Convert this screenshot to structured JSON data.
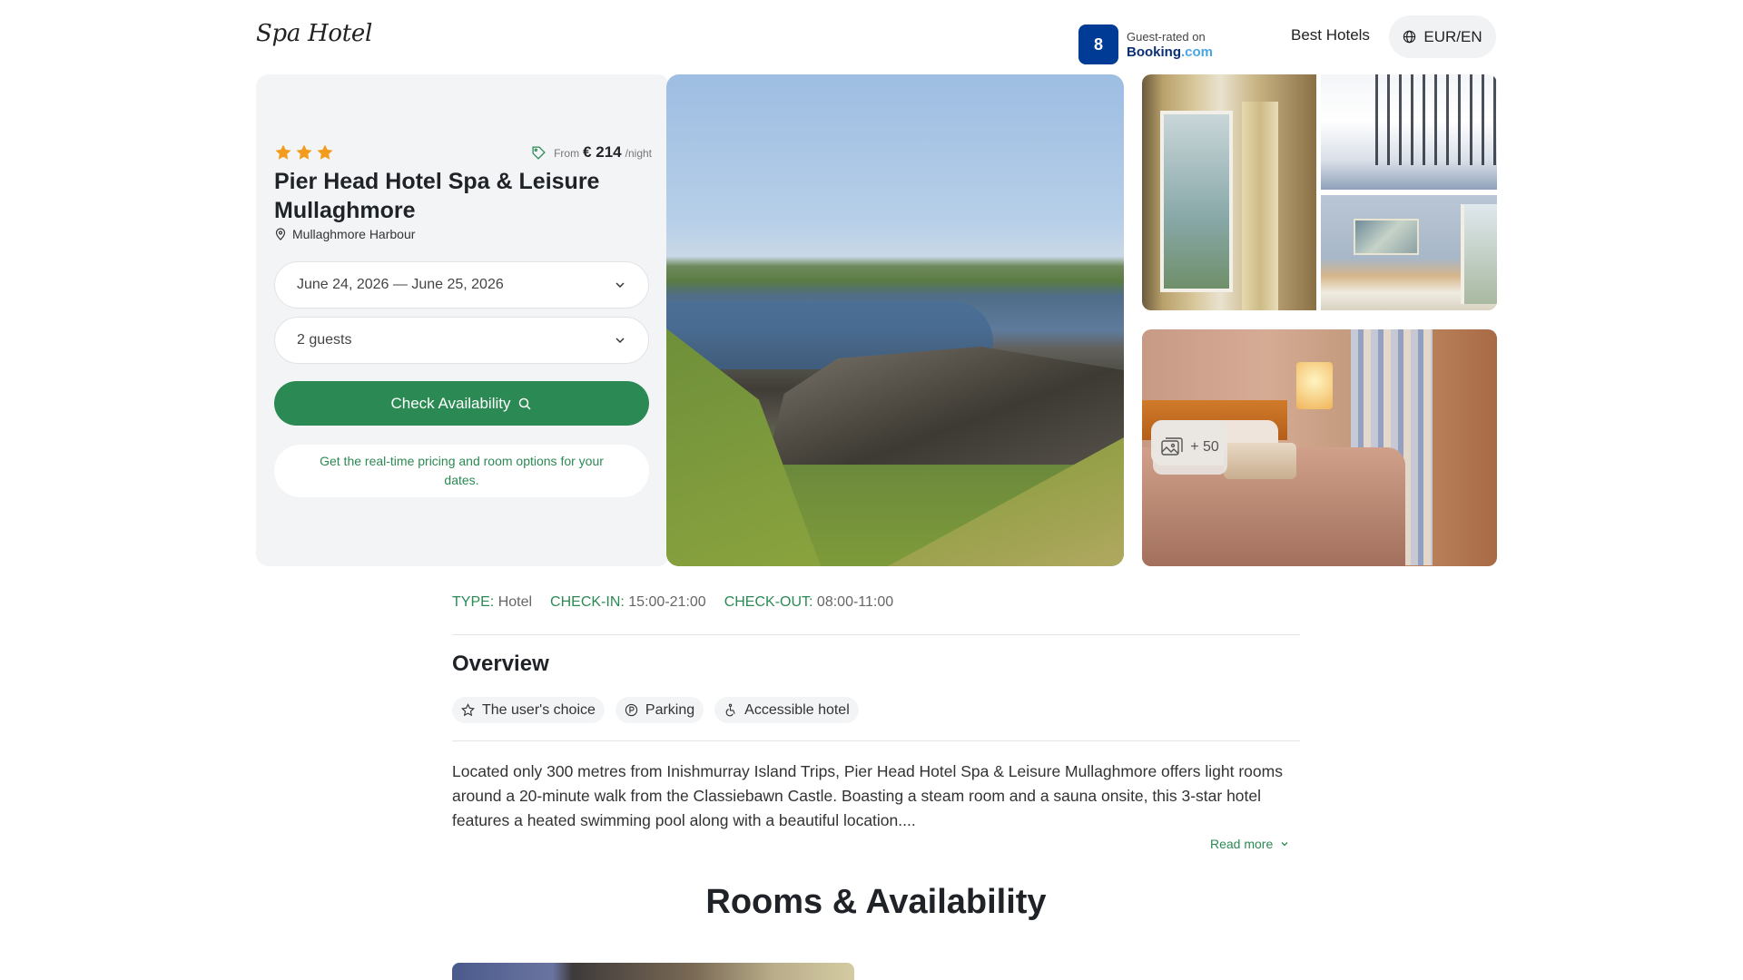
{
  "header": {
    "logo": "Spa Hotel",
    "nav_best_hotels": "Best Hotels",
    "currency_language": "EUR/EN"
  },
  "hotel": {
    "stars": 3,
    "price_prefix": "From",
    "price": "€ 214",
    "price_suffix": "/night",
    "name": "Pier Head Hotel Spa & Leisure Mullaghmore",
    "location": "Mullaghmore Harbour"
  },
  "booking": {
    "dates": "June 24, 2026 — June 25, 2026",
    "guests": "2 guests",
    "check_button": "Check Availability",
    "info_text": "Get the real-time pricing and room options for your dates."
  },
  "rating": {
    "score": "8",
    "label": "Guest-rated on",
    "brand_main": "Booking",
    "brand_dot": ".com"
  },
  "gallery": {
    "more_count": "+ 50"
  },
  "details": {
    "type_label": "TYPE:",
    "type_value": "Hotel",
    "checkin_label": "CHECK-IN:",
    "checkin_value": "15:00-21:00",
    "checkout_label": "CHECK-OUT:",
    "checkout_value": "08:00-11:00"
  },
  "overview": {
    "title": "Overview",
    "chips": [
      "The user's choice",
      "Parking",
      "Accessible hotel"
    ],
    "description": "Located only 300 metres from Inishmurray Island Trips, Pier Head Hotel Spa & Leisure Mullaghmore offers light rooms around a 20-minute walk from the Classiebawn Castle. Boasting a steam room and a sauna onsite, this 3-star hotel features a heated swimming pool along with a beautiful location....",
    "read_more": "Read more"
  },
  "rooms": {
    "title": "Rooms & Availability"
  },
  "colors": {
    "accent_green": "#2b8a53",
    "star_orange": "#f39b1d",
    "booking_blue": "#003b95"
  }
}
